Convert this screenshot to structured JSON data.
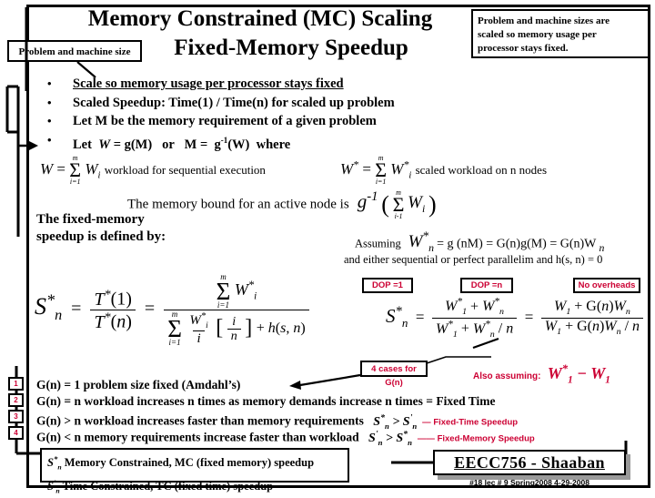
{
  "slide": {
    "title_line1": "Memory Constrained (MC) Scaling",
    "title_line2": "Fixed-Memory Speedup"
  },
  "callouts": {
    "problem_machine_size": "Problem and machine size",
    "top_right": [
      "Problem and machine sizes are",
      "scaled  so memory  usage per",
      "processor stays fixed."
    ]
  },
  "bullets": [
    {
      "marker": "•",
      "text": "Scale so memory usage per processor stays fixed",
      "underline": true
    },
    {
      "marker": "•",
      "text": "Scaled Speedup: Time(1) / Time(n)   for scaled up problem",
      "underline": false
    },
    {
      "marker": "•",
      "text": "Let M be the memory requirement of a given problem",
      "underline": false
    },
    {
      "marker": "•",
      "text": "Let  W = g(M)   or   M =  g-1(W)  where",
      "underline": false
    }
  ],
  "equations": {
    "w_seq_caption": "workload for sequential execution",
    "w_scaled_caption": "scaled workload on n nodes",
    "memory_bound_caption": "The memory bound for an active node is",
    "fixed_memory_label_line1": "The fixed-memory",
    "fixed_memory_label_line2": "speedup is defined by:",
    "assuming_label": "Assuming",
    "assuming_eq": "= g  (nM) = G(n)g(M) = G(n)W",
    "either_line": "and either sequential or perfect parallelim and h(s, n) = 0"
  },
  "annotations": {
    "dop_1": "DOP =1",
    "dop_n": "DOP =n",
    "no_overheads": "No overheads",
    "four_cases": "4 cases for G(n)",
    "also_assuming": "Also assuming:"
  },
  "cases": [
    {
      "num": "1",
      "text": "G(n) = 1  problem size fixed (Amdahl’s)",
      "note": ""
    },
    {
      "num": "2",
      "text": "G(n) = n  workload increases n times as memory demands increase n times = Fixed Time",
      "note": ""
    },
    {
      "num": "3",
      "text": "G(n) > n  workload increases faster than memory requirements",
      "note": "Fixed-Time Speedup"
    },
    {
      "num": "4",
      "text": "G(n) < n memory requirements increase faster than workload",
      "note": "Fixed-Memory Speedup"
    }
  ],
  "definitions": [
    "Memory Constrained, MC (fixed memory) speedup",
    "Time Constrained, TC (fixed time) speedup"
  ],
  "footer": {
    "course": "EECC756 - Shaaban",
    "meta": "#18  lec # 9   Spring2008  4-29-2008"
  },
  "colors": {
    "accent_red": "#CC0033",
    "frame": "#000000",
    "background": "#FFFFFF"
  }
}
